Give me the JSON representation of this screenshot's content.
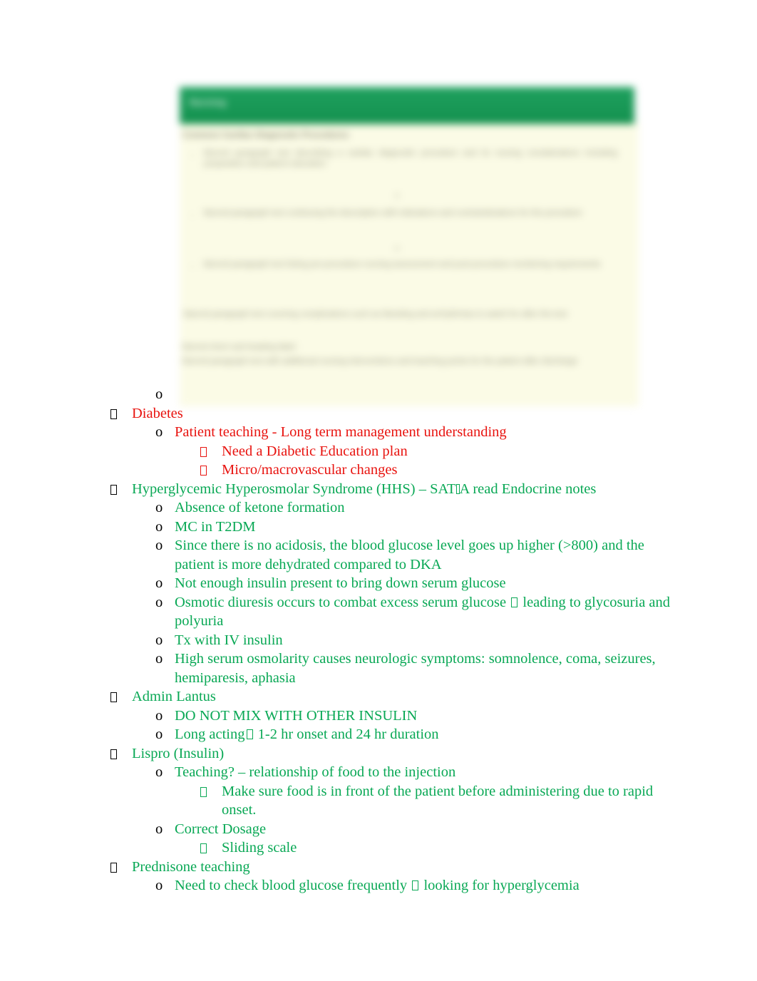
{
  "document": {
    "type": "study-notes-outline",
    "colors": {
      "red_text": "#e8130f",
      "green_text": "#09a855",
      "marker_black": "#000000",
      "figure_header_green": "#17995c",
      "figure_body_cream": "#fbfbe6",
      "page_background": "#ffffff"
    }
  },
  "figure": {
    "description": "blurred screenshot of a clinical reference page",
    "header_title": "Nursing",
    "subtitle": "Common Cardiac Diagnostic Procedures",
    "marker_1": "-",
    "marker_2": "-",
    "marker_3": "-",
    "marker_4": "-",
    "bullet_1": "o",
    "bullet_2": "o",
    "body_line_1": "blurred paragraph text describing a cardiac diagnostic procedure and its nursing considerations including preparation and patient education",
    "body_line_2": "blurred paragraph text continuing the description with indications and contraindications for the procedure",
    "body_line_3": "blurred paragraph text listing pre-procedure nursing assessment and post-procedure monitoring requirements",
    "body_line_4": "blurred paragraph text covering complications such as bleeding and arrhythmias to watch for after the test",
    "body_line_5": "blurred short sub-heading label",
    "body_line_6": "blurred paragraph text with additional nursing interventions and teaching points for the patient after discharge"
  },
  "outline": {
    "items": [
      {
        "level": 2,
        "marker": "o",
        "marker_type": "letter-o",
        "color": "black",
        "text": ""
      },
      {
        "level": 1,
        "marker": "❑",
        "marker_type": "tofu",
        "color": "red",
        "text": "Diabetes"
      },
      {
        "level": 2,
        "marker": "o",
        "marker_type": "letter-o",
        "color": "red",
        "text": "Patient teaching - Long term management understanding"
      },
      {
        "level": 3,
        "marker": "❑",
        "marker_type": "tofu",
        "color": "red",
        "text": "Need a Diabetic Education plan"
      },
      {
        "level": 3,
        "marker": "❑",
        "marker_type": "tofu",
        "color": "red",
        "text": "Micro/macrovascular changes"
      },
      {
        "level": 1,
        "marker": "❑",
        "marker_type": "tofu",
        "color": "green",
        "text_before": "Hyperglycemic Hyperosmolar Syndrome (HHS) – SAT",
        "inline_glyph": "narrow-tofu",
        "text_after": "A  read Endocrine notes"
      },
      {
        "level": 2,
        "marker": "o",
        "marker_type": "letter-o",
        "color": "green",
        "text": "Absence of ketone formation"
      },
      {
        "level": 2,
        "marker": "o",
        "marker_type": "letter-o",
        "color": "green",
        "text": "MC in T2DM"
      },
      {
        "level": 2,
        "marker": "o",
        "marker_type": "letter-o",
        "color": "green",
        "text": "Since there is no acidosis, the blood glucose level goes up higher (>800) and the patient is more dehydrated compared to DKA"
      },
      {
        "level": 2,
        "marker": "o",
        "marker_type": "letter-o",
        "color": "green",
        "text": "Not enough insulin present to bring down serum glucose"
      },
      {
        "level": 2,
        "marker": "o",
        "marker_type": "letter-o",
        "color": "green",
        "text_before": "Osmotic diuresis occurs to combat excess serum glucose ",
        "inline_glyph": "tofu",
        "text_after": "  leading to glycosuria and polyuria"
      },
      {
        "level": 2,
        "marker": "o",
        "marker_type": "letter-o",
        "color": "green",
        "text": "Tx with IV insulin"
      },
      {
        "level": 2,
        "marker": "o",
        "marker_type": "letter-o",
        "color": "green",
        "text": "High serum osmolarity causes neurologic symptoms: somnolence, coma, seizures, hemiparesis, aphasia"
      },
      {
        "level": 1,
        "marker": "❑",
        "marker_type": "tofu",
        "color": "green",
        "text": "Admin Lantus"
      },
      {
        "level": 2,
        "marker": "o",
        "marker_type": "letter-o",
        "color": "green",
        "text": "DO NOT MIX WITH OTHER INSULIN"
      },
      {
        "level": 2,
        "marker": "o",
        "marker_type": "letter-o",
        "color": "green",
        "text_before": "Long acting",
        "inline_glyph": "tofu",
        "text_after": "  1-2 hr onset and 24 hr duration"
      },
      {
        "level": 1,
        "marker": "❑",
        "marker_type": "tofu",
        "color": "green",
        "text": "Lispro (Insulin)"
      },
      {
        "level": 2,
        "marker": "o",
        "marker_type": "letter-o",
        "color": "green",
        "text": "Teaching? – relationship of food to the injection"
      },
      {
        "level": 3,
        "marker": "❑",
        "marker_type": "tofu",
        "color": "green",
        "text": "Make sure food is in front of the patient before administering due to rapid onset."
      },
      {
        "level": 2,
        "marker": "o",
        "marker_type": "letter-o",
        "color": "green",
        "text": "Correct Dosage"
      },
      {
        "level": 3,
        "marker": "❑",
        "marker_type": "tofu",
        "color": "green",
        "text": "Sliding scale"
      },
      {
        "level": 1,
        "marker": "❑",
        "marker_type": "tofu",
        "color": "green",
        "text": "Prednisone teaching"
      },
      {
        "level": 2,
        "marker": "o",
        "marker_type": "letter-o",
        "color": "green",
        "text_before": "Need to check blood glucose frequently ",
        "inline_glyph": "tofu",
        "text_after": "  looking for hyperglycemia"
      }
    ]
  }
}
